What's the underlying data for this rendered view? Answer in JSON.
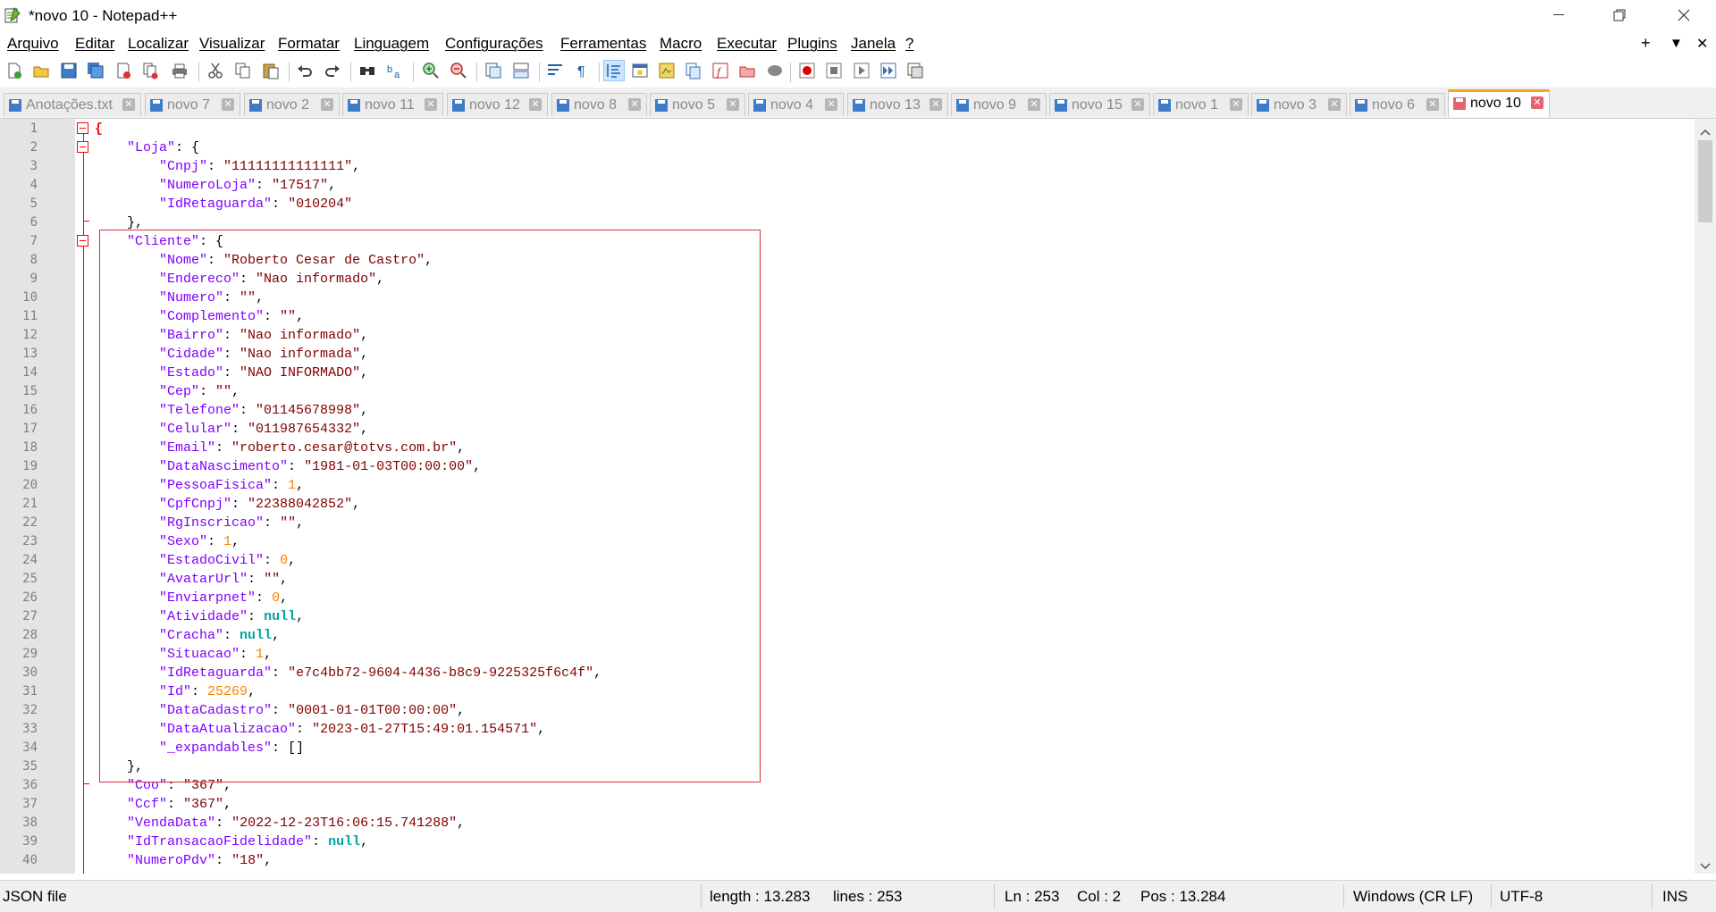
{
  "window": {
    "title": "*novo 10 - Notepad++"
  },
  "menu": [
    "Arquivo",
    "Editar",
    "Localizar",
    "Visualizar",
    "Formatar",
    "Linguagem",
    "Configurações",
    "Ferramentas",
    "Macro",
    "Executar",
    "Plugins",
    "Janela",
    "?"
  ],
  "menu_right": {
    "add": "+",
    "list": "▼",
    "close": "✕"
  },
  "tabs": [
    {
      "label": "Anotações.txt"
    },
    {
      "label": "novo 7"
    },
    {
      "label": "novo 2"
    },
    {
      "label": "novo 11"
    },
    {
      "label": "novo 12"
    },
    {
      "label": "novo 8"
    },
    {
      "label": "novo 5"
    },
    {
      "label": "novo 4"
    },
    {
      "label": "novo 13"
    },
    {
      "label": "novo 9"
    },
    {
      "label": "novo 15"
    },
    {
      "label": "novo 1"
    },
    {
      "label": "novo 3"
    },
    {
      "label": "novo 6"
    },
    {
      "label": "novo 10"
    }
  ],
  "active_tab": "novo 10",
  "editor": {
    "line_numbers": [
      "1",
      "2",
      "3",
      "4",
      "5",
      "6",
      "7",
      "8",
      "9",
      "10",
      "11",
      "12",
      "13",
      "14",
      "15",
      "16",
      "17",
      "18",
      "19",
      "20",
      "21",
      "22",
      "23",
      "24",
      "25",
      "26",
      "27",
      "28",
      "29",
      "30",
      "31",
      "32",
      "33",
      "34",
      "35",
      "36",
      "37",
      "38",
      "39",
      "40"
    ],
    "lines": [
      [
        [
          "br",
          "{"
        ]
      ],
      [
        [
          "p",
          "    "
        ],
        [
          "k",
          "\"Loja\""
        ],
        [
          "p",
          ": {"
        ]
      ],
      [
        [
          "p",
          "        "
        ],
        [
          "k",
          "\"Cnpj\""
        ],
        [
          "p",
          ": "
        ],
        [
          "v",
          "\"11111111111111\""
        ],
        [
          "p",
          ","
        ]
      ],
      [
        [
          "p",
          "        "
        ],
        [
          "k",
          "\"NumeroLoja\""
        ],
        [
          "p",
          ": "
        ],
        [
          "v",
          "\"17517\""
        ],
        [
          "p",
          ","
        ]
      ],
      [
        [
          "p",
          "        "
        ],
        [
          "k",
          "\"IdRetaguarda\""
        ],
        [
          "p",
          ": "
        ],
        [
          "v",
          "\"010204\""
        ]
      ],
      [
        [
          "p",
          "    },"
        ]
      ],
      [
        [
          "p",
          "    "
        ],
        [
          "k",
          "\"Cliente\""
        ],
        [
          "p",
          ": {"
        ]
      ],
      [
        [
          "p",
          "        "
        ],
        [
          "k",
          "\"Nome\""
        ],
        [
          "p",
          ": "
        ],
        [
          "v",
          "\"Roberto Cesar de Castro\""
        ],
        [
          "p",
          ","
        ]
      ],
      [
        [
          "p",
          "        "
        ],
        [
          "k",
          "\"Endereco\""
        ],
        [
          "p",
          ": "
        ],
        [
          "v",
          "\"Nao informado\""
        ],
        [
          "p",
          ","
        ]
      ],
      [
        [
          "p",
          "        "
        ],
        [
          "k",
          "\"Numero\""
        ],
        [
          "p",
          ": "
        ],
        [
          "v",
          "\"\""
        ],
        [
          "p",
          ","
        ]
      ],
      [
        [
          "p",
          "        "
        ],
        [
          "k",
          "\"Complemento\""
        ],
        [
          "p",
          ": "
        ],
        [
          "v",
          "\"\""
        ],
        [
          "p",
          ","
        ]
      ],
      [
        [
          "p",
          "        "
        ],
        [
          "k",
          "\"Bairro\""
        ],
        [
          "p",
          ": "
        ],
        [
          "v",
          "\"Nao informado\""
        ],
        [
          "p",
          ","
        ]
      ],
      [
        [
          "p",
          "        "
        ],
        [
          "k",
          "\"Cidade\""
        ],
        [
          "p",
          ": "
        ],
        [
          "v",
          "\"Nao informada\""
        ],
        [
          "p",
          ","
        ]
      ],
      [
        [
          "p",
          "        "
        ],
        [
          "k",
          "\"Estado\""
        ],
        [
          "p",
          ": "
        ],
        [
          "v",
          "\"NAO INFORMADO\""
        ],
        [
          "p",
          ","
        ]
      ],
      [
        [
          "p",
          "        "
        ],
        [
          "k",
          "\"Cep\""
        ],
        [
          "p",
          ": "
        ],
        [
          "v",
          "\"\""
        ],
        [
          "p",
          ","
        ]
      ],
      [
        [
          "p",
          "        "
        ],
        [
          "k",
          "\"Telefone\""
        ],
        [
          "p",
          ": "
        ],
        [
          "v",
          "\"01145678998\""
        ],
        [
          "p",
          ","
        ]
      ],
      [
        [
          "p",
          "        "
        ],
        [
          "k",
          "\"Celular\""
        ],
        [
          "p",
          ": "
        ],
        [
          "v",
          "\"011987654332\""
        ],
        [
          "p",
          ","
        ]
      ],
      [
        [
          "p",
          "        "
        ],
        [
          "k",
          "\"Email\""
        ],
        [
          "p",
          ": "
        ],
        [
          "v",
          "\"roberto.cesar@totvs.com.br\""
        ],
        [
          "p",
          ","
        ]
      ],
      [
        [
          "p",
          "        "
        ],
        [
          "k",
          "\"DataNascimento\""
        ],
        [
          "p",
          ": "
        ],
        [
          "v",
          "\"1981-01-03T00:00:00\""
        ],
        [
          "p",
          ","
        ]
      ],
      [
        [
          "p",
          "        "
        ],
        [
          "k",
          "\"PessoaFisica\""
        ],
        [
          "p",
          ": "
        ],
        [
          "n",
          "1"
        ],
        [
          "p",
          ","
        ]
      ],
      [
        [
          "p",
          "        "
        ],
        [
          "k",
          "\"CpfCnpj\""
        ],
        [
          "p",
          ": "
        ],
        [
          "v",
          "\"22388042852\""
        ],
        [
          "p",
          ","
        ]
      ],
      [
        [
          "p",
          "        "
        ],
        [
          "k",
          "\"RgInscricao\""
        ],
        [
          "p",
          ": "
        ],
        [
          "v",
          "\"\""
        ],
        [
          "p",
          ","
        ]
      ],
      [
        [
          "p",
          "        "
        ],
        [
          "k",
          "\"Sexo\""
        ],
        [
          "p",
          ": "
        ],
        [
          "n",
          "1"
        ],
        [
          "p",
          ","
        ]
      ],
      [
        [
          "p",
          "        "
        ],
        [
          "k",
          "\"EstadoCivil\""
        ],
        [
          "p",
          ": "
        ],
        [
          "n",
          "0"
        ],
        [
          "p",
          ","
        ]
      ],
      [
        [
          "p",
          "        "
        ],
        [
          "k",
          "\"AvatarUrl\""
        ],
        [
          "p",
          ": "
        ],
        [
          "v",
          "\"\""
        ],
        [
          "p",
          ","
        ]
      ],
      [
        [
          "p",
          "        "
        ],
        [
          "k",
          "\"Enviarpnet\""
        ],
        [
          "p",
          ": "
        ],
        [
          "n",
          "0"
        ],
        [
          "p",
          ","
        ]
      ],
      [
        [
          "p",
          "        "
        ],
        [
          "k",
          "\"Atividade\""
        ],
        [
          "p",
          ": "
        ],
        [
          "nl",
          "null"
        ],
        [
          "p",
          ","
        ]
      ],
      [
        [
          "p",
          "        "
        ],
        [
          "k",
          "\"Cracha\""
        ],
        [
          "p",
          ": "
        ],
        [
          "nl",
          "null"
        ],
        [
          "p",
          ","
        ]
      ],
      [
        [
          "p",
          "        "
        ],
        [
          "k",
          "\"Situacao\""
        ],
        [
          "p",
          ": "
        ],
        [
          "n",
          "1"
        ],
        [
          "p",
          ","
        ]
      ],
      [
        [
          "p",
          "        "
        ],
        [
          "k",
          "\"IdRetaguarda\""
        ],
        [
          "p",
          ": "
        ],
        [
          "v",
          "\"e7c4bb72-9604-4436-b8c9-9225325f6c4f\""
        ],
        [
          "p",
          ","
        ]
      ],
      [
        [
          "p",
          "        "
        ],
        [
          "k",
          "\"Id\""
        ],
        [
          "p",
          ": "
        ],
        [
          "n",
          "25269"
        ],
        [
          "p",
          ","
        ]
      ],
      [
        [
          "p",
          "        "
        ],
        [
          "k",
          "\"DataCadastro\""
        ],
        [
          "p",
          ": "
        ],
        [
          "v",
          "\"0001-01-01T00:00:00\""
        ],
        [
          "p",
          ","
        ]
      ],
      [
        [
          "p",
          "        "
        ],
        [
          "k",
          "\"DataAtualizacao\""
        ],
        [
          "p",
          ": "
        ],
        [
          "v",
          "\"2023-01-27T15:49:01.154571\""
        ],
        [
          "p",
          ","
        ]
      ],
      [
        [
          "p",
          "        "
        ],
        [
          "k",
          "\"_expandables\""
        ],
        [
          "p",
          ": []"
        ]
      ],
      [
        [
          "p",
          "    },"
        ]
      ],
      [
        [
          "p",
          "    "
        ],
        [
          "k",
          "\"Coo\""
        ],
        [
          "p",
          ": "
        ],
        [
          "v",
          "\"367\""
        ],
        [
          "p",
          ","
        ]
      ],
      [
        [
          "p",
          "    "
        ],
        [
          "k",
          "\"Ccf\""
        ],
        [
          "p",
          ": "
        ],
        [
          "v",
          "\"367\""
        ],
        [
          "p",
          ","
        ]
      ],
      [
        [
          "p",
          "    "
        ],
        [
          "k",
          "\"VendaData\""
        ],
        [
          "p",
          ": "
        ],
        [
          "v",
          "\"2022-12-23T16:06:15.741288\""
        ],
        [
          "p",
          ","
        ]
      ],
      [
        [
          "p",
          "    "
        ],
        [
          "k",
          "\"IdTransacaoFidelidade\""
        ],
        [
          "p",
          ": "
        ],
        [
          "nl",
          "null"
        ],
        [
          "p",
          ","
        ]
      ],
      [
        [
          "p",
          "    "
        ],
        [
          "k",
          "\"NumeroPdv\""
        ],
        [
          "p",
          ": "
        ],
        [
          "v",
          "\"18\""
        ],
        [
          "p",
          ","
        ]
      ]
    ]
  },
  "status": {
    "file_type": "JSON file",
    "length": "length : 13.283",
    "lines": "lines : 253",
    "ln": "Ln : 253",
    "col": "Col : 2",
    "pos": "Pos : 13.284",
    "eol": "Windows (CR LF)",
    "encoding": "UTF-8",
    "mode": "INS"
  },
  "colors": {
    "tab_active_accent": "#f5a623",
    "highlight_box": "#d6333f",
    "fold": "#ff0000",
    "key": "#8000ff",
    "string": "#800000",
    "number": "#ff8000",
    "null": "#00a3a3"
  }
}
